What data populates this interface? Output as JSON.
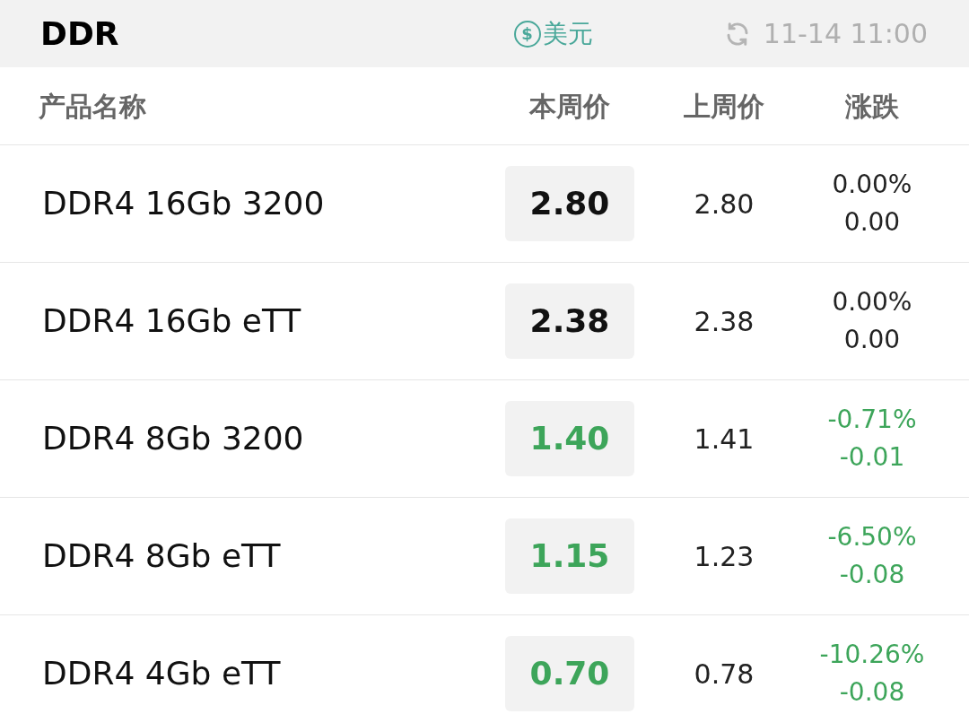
{
  "header": {
    "title": "DDR",
    "currency_symbol": "$",
    "currency": "美元",
    "updated": "11-14 11:00"
  },
  "columns": [
    "产品名称",
    "本周价",
    "上周价",
    "涨跌"
  ],
  "rows": [
    {
      "name": "DDR4 16Gb 3200",
      "price": "2.80",
      "last": "2.80",
      "pct": "0.00%",
      "diff": "0.00",
      "kind": "flat"
    },
    {
      "name": "DDR4 16Gb eTT",
      "price": "2.38",
      "last": "2.38",
      "pct": "0.00%",
      "diff": "0.00",
      "kind": "flat"
    },
    {
      "name": "DDR4 8Gb 3200",
      "price": "1.40",
      "last": "1.41",
      "pct": "-0.71%",
      "diff": "-0.01",
      "kind": "down"
    },
    {
      "name": "DDR4 8Gb eTT",
      "price": "1.15",
      "last": "1.23",
      "pct": "-6.50%",
      "diff": "-0.08",
      "kind": "down"
    },
    {
      "name": "DDR4 4Gb eTT",
      "price": "0.70",
      "last": "0.78",
      "pct": "-10.26%",
      "diff": "-0.08",
      "kind": "down"
    }
  ]
}
